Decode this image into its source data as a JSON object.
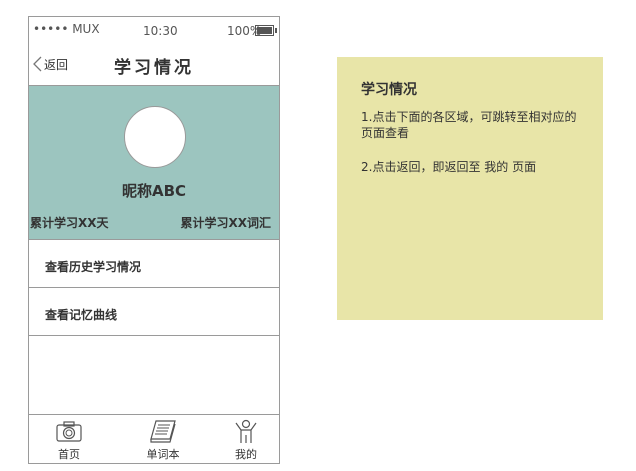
{
  "statusbar": {
    "signal": "••••• MUX",
    "time": "10:30",
    "battery": "100%"
  },
  "navbar": {
    "back_label": "返回",
    "title": "学习情况"
  },
  "profile": {
    "nickname": "昵称ABC",
    "total_days": "累计学习XX天",
    "total_words": "累计学习XX词汇"
  },
  "menu": {
    "items": [
      {
        "label": "查看历史学习情况"
      },
      {
        "label": "查看记忆曲线"
      }
    ]
  },
  "tabbar": {
    "tabs": [
      {
        "label": "首页",
        "icon": "camera-icon"
      },
      {
        "label": "单词本",
        "icon": "book-icon"
      },
      {
        "label": "我的",
        "icon": "person-icon"
      }
    ]
  },
  "note": {
    "title": "学习情况",
    "lines": [
      "1.点击下面的各区域，可跳转至相对应的页面查看",
      "2.点击返回，即返回至 我的 页面"
    ]
  },
  "colors": {
    "profile_bg": "#9cc5bf",
    "note_bg": "#e8e5a8"
  }
}
